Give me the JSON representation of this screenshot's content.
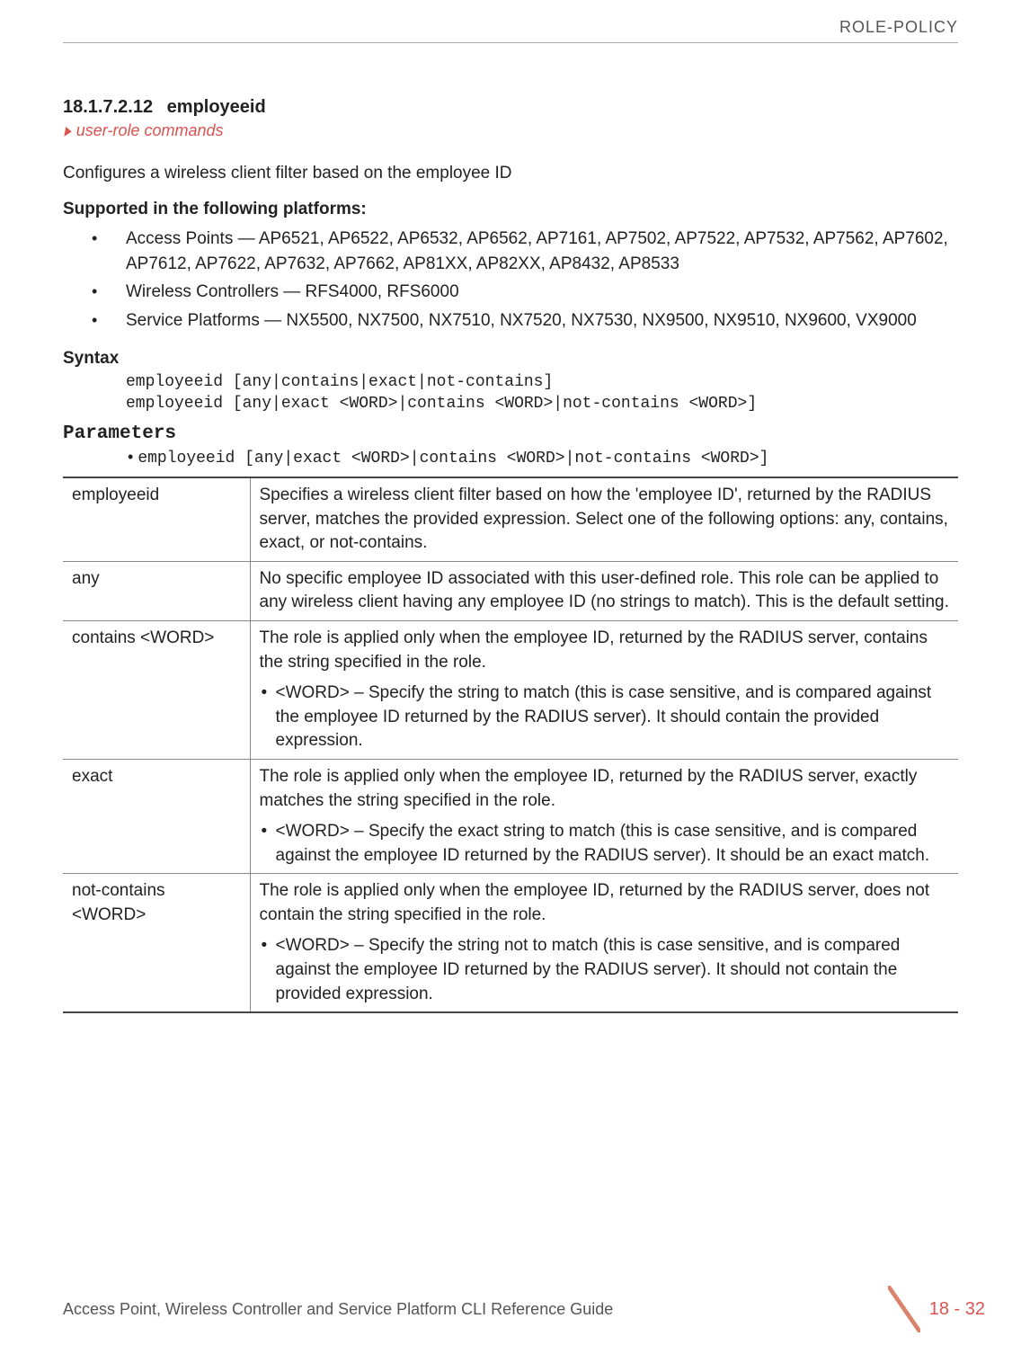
{
  "header": {
    "category": "ROLE-POLICY"
  },
  "section": {
    "number": "18.1.7.2.12",
    "title": "employeeid"
  },
  "crossref": "user-role commands",
  "intro": "Configures a wireless client filter based on the employee ID",
  "platforms": {
    "heading": "Supported in the following platforms:",
    "items": [
      "Access Points — AP6521, AP6522, AP6532, AP6562, AP7161, AP7502, AP7522, AP7532, AP7562, AP7602, AP7612, AP7622, AP7632, AP7662, AP81XX, AP82XX, AP8432, AP8533",
      "Wireless Controllers — RFS4000, RFS6000",
      "Service Platforms — NX5500, NX7500, NX7510, NX7520, NX7530, NX9500, NX9510, NX9600, VX9000"
    ]
  },
  "syntax": {
    "heading": "Syntax",
    "code": "employeeid [any|contains|exact|not-contains]\nemployeeid [any|exact <WORD>|contains <WORD>|not-contains <WORD>]"
  },
  "parameters": {
    "heading": "Parameters",
    "bullet": "employeeid [any|exact <WORD>|contains <WORD>|not-contains <WORD>]",
    "rows": [
      {
        "name": "employeeid",
        "desc": "Specifies a wireless client filter based on how the 'employee ID', returned by the RADIUS server, matches the provided expression. Select one of the following options: any, contains, exact, or not-contains."
      },
      {
        "name": "any",
        "desc": "No specific employee ID associated with this user-defined role. This role can be applied to any wireless client having any employee ID (no strings to match). This is the default setting."
      },
      {
        "name": "contains <WORD>",
        "desc": "The role is applied only when the employee ID, returned by the RADIUS server, contains the string specified in the role.",
        "sub": "<WORD> – Specify the string to match (this is case sensitive, and is compared against the employee ID returned by the RADIUS server). It should contain the provided expression."
      },
      {
        "name": "exact",
        "desc": "The role is applied only when the employee ID, returned by the RADIUS server, exactly matches the string specified in the role.",
        "sub": "<WORD> – Specify the exact string to match (this is case sensitive, and is compared against the employee ID returned by the RADIUS server). It should be an exact match."
      },
      {
        "name": "not-contains <WORD>",
        "desc": "The role is applied only when the employee ID, returned by the RADIUS server, does not contain the string specified in the role.",
        "sub": "<WORD> – Specify the string not to match (this is case sensitive, and is compared against the employee ID returned by the RADIUS server). It should not contain the provided expression."
      }
    ]
  },
  "footer": {
    "text": "Access Point, Wireless Controller and Service Platform CLI Reference Guide",
    "page": "18 - 32"
  }
}
